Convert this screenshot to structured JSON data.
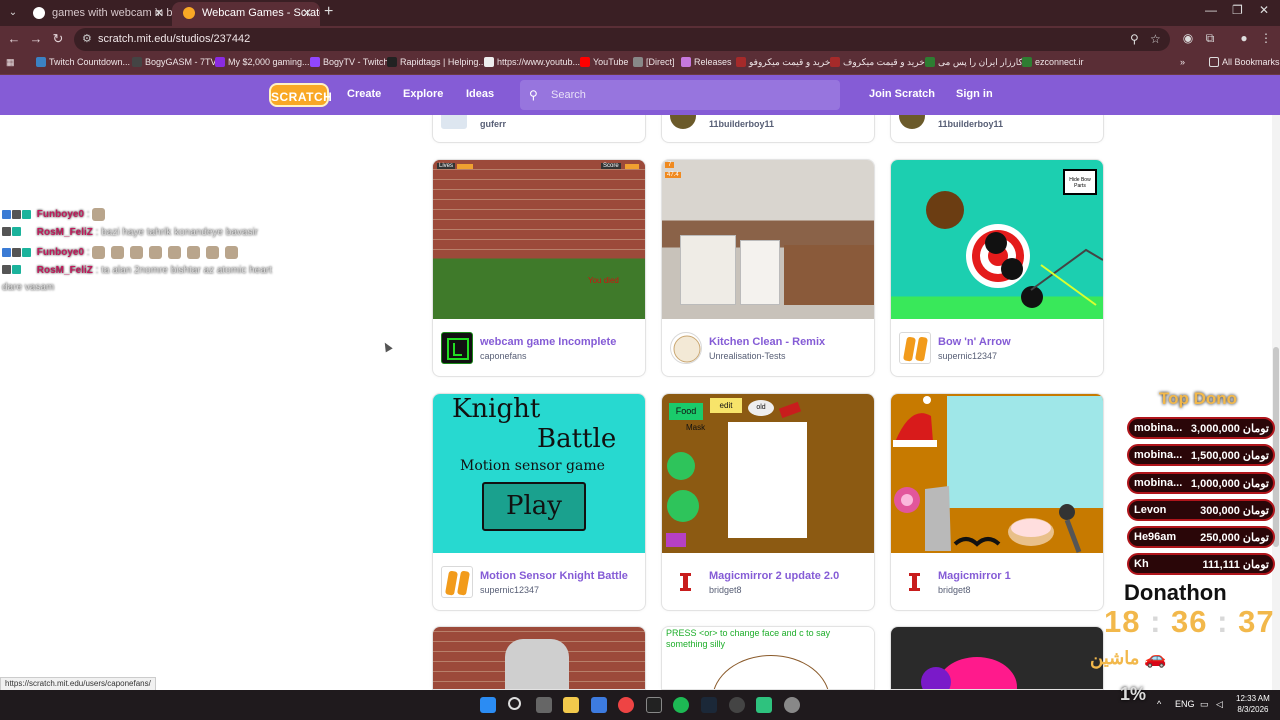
{
  "browser": {
    "tabs": [
      {
        "title": "games with webcam in browser",
        "active": false
      },
      {
        "title": "Webcam Games - Scratch Studio",
        "active": true
      }
    ],
    "url": "scratch.mit.edu/studios/237442",
    "bookmarks": [
      "Twitch Countdown...",
      "BogyGASM - 7TV",
      "My $2,000 gaming...",
      "BogyTV - Twitch",
      "Rapidtags | Helping...",
      "https://www.youtub...",
      "YouTube",
      "[Direct]",
      "Releases",
      "خرید و قیمت میکروفو...",
      "خرید و قیمت میکروف...",
      "کارزار ایران را پس می...",
      "ezconnect.ir"
    ],
    "all_bookmarks": "All Bookmarks",
    "status_url": "https://scratch.mit.edu/users/caponefans/"
  },
  "scratch_nav": {
    "logo": "SCRATCH",
    "create": "Create",
    "explore": "Explore",
    "ideas": "Ideas",
    "search_placeholder": "Search",
    "join": "Join Scratch",
    "signin": "Sign in"
  },
  "top_partial_cards": [
    {
      "user": "guferr"
    },
    {
      "user": "11builderboy11"
    },
    {
      "user": "11builderboy11"
    }
  ],
  "projects": [
    {
      "title": "webcam game Incomplete",
      "user": "caponefans"
    },
    {
      "title": "Kitchen Clean - Remix",
      "user": "Unrealisation-Tests"
    },
    {
      "title": "Bow 'n' Arrow",
      "user": "supernic12347"
    },
    {
      "title": "Motion Sensor Knight Battle",
      "user": "supernic12347"
    },
    {
      "title": "Magicmirror 2 update 2.0",
      "user": "bridget8"
    },
    {
      "title": "Magicmirror 1",
      "user": "bridget8"
    }
  ],
  "thumb_text": {
    "webcam_lives": "Lives",
    "webcam_score": "Score",
    "webcam_red": "You died",
    "kitchen_counter": "7",
    "kitchen_counter2": "47.4",
    "bow_button": "Hide Bow Parts",
    "knight_line1": "Knight",
    "knight_line2": "Battle",
    "knight_line3": "Motion sensor game",
    "knight_play": "Play",
    "mm2_food": "Food",
    "mm2_edit": "edit",
    "mm2_old": "old",
    "mm2_mask": "Mask",
    "bottom_press": "PRESS <or> to change face and c to say something silly"
  },
  "chat": [
    {
      "user": "Funboye0",
      "color": "#c2185b",
      "text": "",
      "emotes": 1
    },
    {
      "user": "RosM_FeliZ",
      "color": "#c2185b",
      "text": "bazi haye tahrik konandeye bavasir",
      "emotes": 0
    },
    {
      "user": "Funboye0",
      "color": "#c2185b",
      "text": "",
      "emotes": 8
    },
    {
      "user": "RosM_FeliZ",
      "color": "#c2185b",
      "text": "ta alan 2nomre bishtar az atomic heart",
      "emotes": 0
    }
  ],
  "chat_wrap": "dare vasam",
  "dono": {
    "title": "Top Dono",
    "rows": [
      {
        "name": "mobina...",
        "amount": "3,000,000 تومان"
      },
      {
        "name": "mobina...",
        "amount": "1,500,000 تومان"
      },
      {
        "name": "mobina...",
        "amount": "1,000,000 تومان"
      },
      {
        "name": "Levon",
        "amount": "300,000 تومان"
      },
      {
        "name": "He96am",
        "amount": "250,000 تومان"
      },
      {
        "name": "Kh",
        "amount": "111,111 تومان"
      }
    ],
    "donathon": "Donathon",
    "timer_h": "18",
    "timer_m": "36",
    "timer_s": "37",
    "machine": "ماشین 🚗",
    "percent": "1%"
  },
  "taskbar": {
    "lang": "ENG",
    "time": "12:33 AM",
    "date": "8/3/2026"
  },
  "colors": {
    "scratch_purple": "#855cd6",
    "chrome_dark": "#3a1f24",
    "chrome_mid": "#5a2e36",
    "dono_gold": "#f2b84b"
  }
}
